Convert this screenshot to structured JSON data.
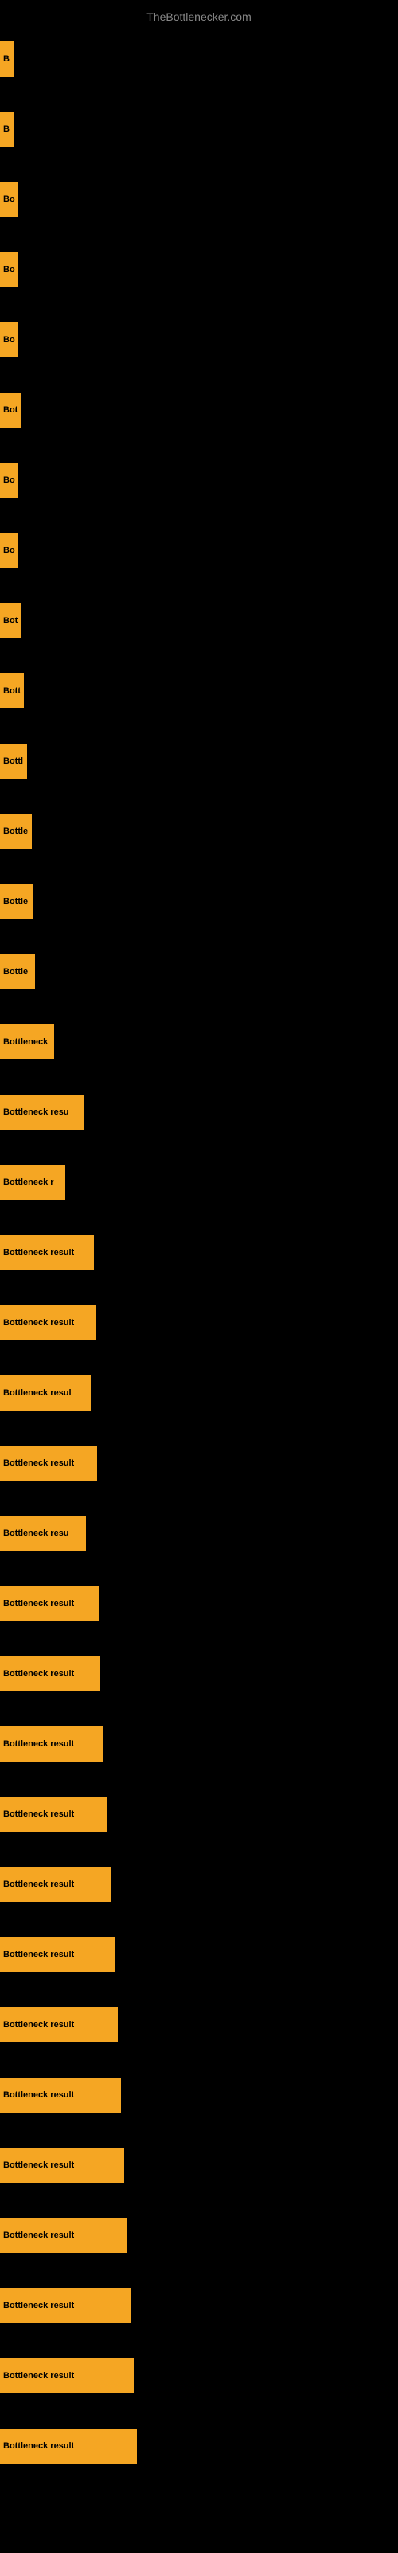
{
  "site_title": "TheBottlenecker.com",
  "bars": [
    {
      "id": 1,
      "label": "B",
      "width": 18
    },
    {
      "id": 2,
      "label": "B",
      "width": 18
    },
    {
      "id": 3,
      "label": "Bo",
      "width": 22
    },
    {
      "id": 4,
      "label": "Bo",
      "width": 22
    },
    {
      "id": 5,
      "label": "Bo",
      "width": 22
    },
    {
      "id": 6,
      "label": "Bot",
      "width": 26
    },
    {
      "id": 7,
      "label": "Bo",
      "width": 22
    },
    {
      "id": 8,
      "label": "Bo",
      "width": 22
    },
    {
      "id": 9,
      "label": "Bot",
      "width": 26
    },
    {
      "id": 10,
      "label": "Bott",
      "width": 30
    },
    {
      "id": 11,
      "label": "Bottl",
      "width": 34
    },
    {
      "id": 12,
      "label": "Bottle",
      "width": 40
    },
    {
      "id": 13,
      "label": "Bottle",
      "width": 42
    },
    {
      "id": 14,
      "label": "Bottle",
      "width": 44
    },
    {
      "id": 15,
      "label": "Bottleneck",
      "width": 68
    },
    {
      "id": 16,
      "label": "Bottleneck resu",
      "width": 105
    },
    {
      "id": 17,
      "label": "Bottleneck r",
      "width": 82
    },
    {
      "id": 18,
      "label": "Bottleneck result",
      "width": 118
    },
    {
      "id": 19,
      "label": "Bottleneck result",
      "width": 120
    },
    {
      "id": 20,
      "label": "Bottleneck resul",
      "width": 114
    },
    {
      "id": 21,
      "label": "Bottleneck result",
      "width": 122
    },
    {
      "id": 22,
      "label": "Bottleneck resu",
      "width": 108
    },
    {
      "id": 23,
      "label": "Bottleneck result",
      "width": 124
    },
    {
      "id": 24,
      "label": "Bottleneck result",
      "width": 126
    },
    {
      "id": 25,
      "label": "Bottleneck result",
      "width": 130
    },
    {
      "id": 26,
      "label": "Bottleneck result",
      "width": 134
    },
    {
      "id": 27,
      "label": "Bottleneck result",
      "width": 140
    },
    {
      "id": 28,
      "label": "Bottleneck result",
      "width": 145
    },
    {
      "id": 29,
      "label": "Bottleneck result",
      "width": 148
    },
    {
      "id": 30,
      "label": "Bottleneck result",
      "width": 152
    },
    {
      "id": 31,
      "label": "Bottleneck result",
      "width": 156
    },
    {
      "id": 32,
      "label": "Bottleneck result",
      "width": 160
    },
    {
      "id": 33,
      "label": "Bottleneck result",
      "width": 165
    },
    {
      "id": 34,
      "label": "Bottleneck result",
      "width": 168
    },
    {
      "id": 35,
      "label": "Bottleneck result",
      "width": 172
    }
  ]
}
